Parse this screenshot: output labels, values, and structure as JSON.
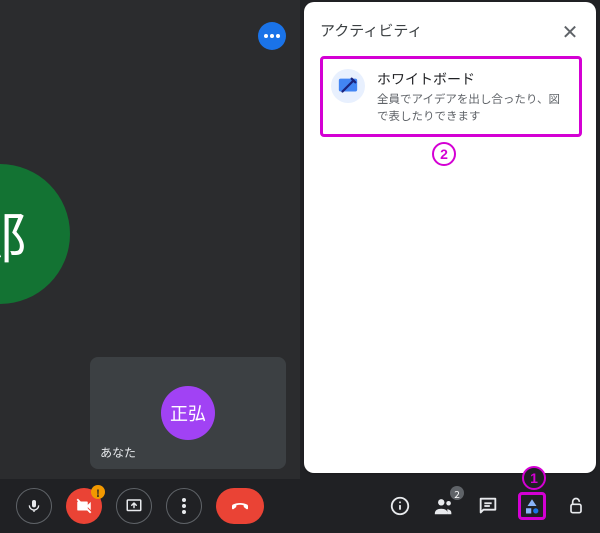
{
  "panel": {
    "title": "アクティビティ",
    "item": {
      "title": "ホワイトボード",
      "desc": "全員でアイデアを出し合ったり、図で表したりできます"
    }
  },
  "video": {
    "big_avatar_text": "郎",
    "self_avatar_text": "正弘",
    "self_label": "あなた"
  },
  "annotations": {
    "one": "1",
    "two": "2"
  },
  "badges": {
    "camera_warning": "!",
    "participant_count": "2"
  }
}
